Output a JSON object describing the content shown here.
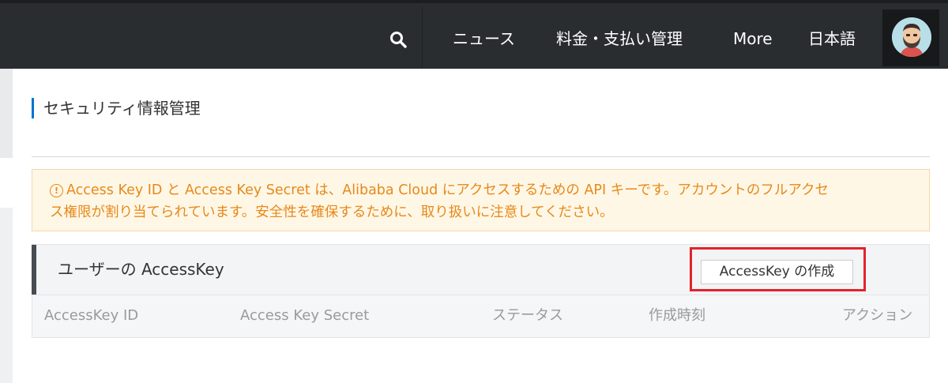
{
  "topbar": {
    "search_icon": "search-icon",
    "nav_items": [
      "ニュース",
      "料金・支払い管理",
      "More",
      "日本語"
    ],
    "avatar_icon": "user-avatar"
  },
  "page": {
    "title": "セキュリティ情報管理"
  },
  "warning": {
    "icon": "warning-circle-icon",
    "line1": "Access Key ID と Access Key Secret は、Alibaba Cloud にアクセスするための API キーです。アカウントのフルアクセ",
    "line2": "ス権限が割り当てられています。安全性を確保するために、取り扱いに注意してください。"
  },
  "accesskey_panel": {
    "title": "ユーザーの AccessKey",
    "create_button": "AccessKey の作成",
    "columns": [
      "AccessKey ID",
      "Access Key Secret",
      "ステータス",
      "作成時刻",
      "アクション"
    ]
  },
  "colors": {
    "topbar_bg": "#2a2d30",
    "accent_blue": "#0073d1",
    "warning_text": "#e6891a",
    "highlight_red": "#e4222b"
  }
}
